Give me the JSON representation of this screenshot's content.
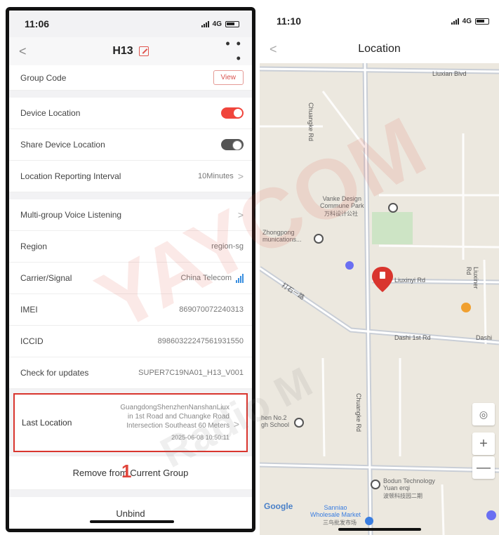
{
  "left": {
    "status": {
      "time": "11:06",
      "network": "4G"
    },
    "nav": {
      "back": "<",
      "title": "H13",
      "more": "• • •"
    },
    "group_code": {
      "label": "Group Code",
      "button": "View"
    },
    "device_location": {
      "label": "Device Location",
      "enabled": true
    },
    "share_location": {
      "label": "Share Device Location",
      "enabled": false
    },
    "reporting_interval": {
      "label": "Location Reporting Interval",
      "value": "10Minutes"
    },
    "voice_listening": {
      "label": "Multi-group Voice Listening"
    },
    "region": {
      "label": "Region",
      "value": "region-sg"
    },
    "carrier": {
      "label": "Carrier/Signal",
      "value": "China Telecom"
    },
    "imei": {
      "label": "IMEI",
      "value": "869070072240313"
    },
    "iccid": {
      "label": "ICCID",
      "value": "89860322247561931550"
    },
    "updates": {
      "label": "Check for updates",
      "value": "SUPER7C19NA01_H13_V001"
    },
    "last_location": {
      "label": "Last Location",
      "line1": "GuangdongShenzhenNanshanLiux",
      "line2": "in 1st Road and Chuangke Road",
      "line3": "Intersection Southeast 60 Meters",
      "time": "2025-06-08 10:50:11"
    },
    "remove_button": "Remove from Current Group",
    "step_marker": "1",
    "unbind_button": "Unbind"
  },
  "right": {
    "status": {
      "time": "11:10",
      "network": "4G"
    },
    "nav": {
      "back": "<",
      "title": "Location"
    },
    "map": {
      "roads": {
        "liuxian": "Liuxian Blvd",
        "chuangke_top": "Chuangke Rd",
        "liuxinyi": "Liuxinyi Rd",
        "dashi": "Dashi 1st Rd",
        "dashi2": "Dashi",
        "chuangke_bottom": "Chuangke Rd",
        "liuxiner": "Liuxiner Rd",
        "diagonal": "打石一路"
      },
      "places": {
        "vanke": "Vanke Design\nCommune Park",
        "vanke_cn": "万科设计公社",
        "zhongpong": "Zhongpong\nmunications...",
        "school": "hen No.2\ngh School",
        "bodun": "Bodun Technology\nYuan erqi",
        "bodun_cn": "波顿科技园二期",
        "sanniao": "Sanniao\nWholesale Market",
        "sanniao_cn": "三鸟批发市场"
      },
      "attribution": "Google",
      "zoom_in": "+",
      "zoom_out": "—"
    },
    "watermark": "YAYCOM",
    "watermark2": "Radio M"
  }
}
